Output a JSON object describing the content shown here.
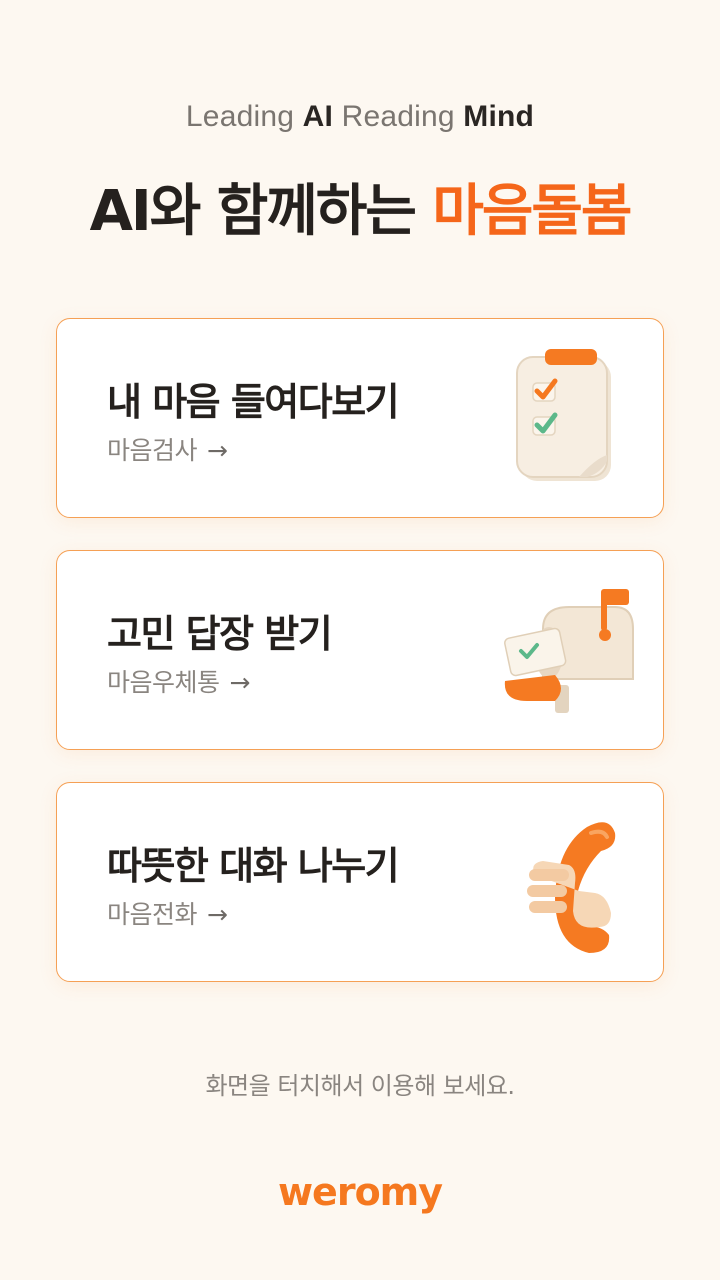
{
  "header": {
    "tagline_parts": [
      "Leading ",
      "AI",
      " Reading ",
      "Mind"
    ],
    "headline_main": "AI와 함께하는 ",
    "headline_accent": "마음돌봄",
    "accent_color": "#f5661a"
  },
  "cards": [
    {
      "title": "내 마음 들여다보기",
      "subtitle": "마음검사",
      "arrow": "→",
      "icon": "checklist-clipboard-icon"
    },
    {
      "title": "고민 답장 받기",
      "subtitle": "마음우체통",
      "arrow": "→",
      "icon": "mailbox-icon"
    },
    {
      "title": "따뜻한 대화 나누기",
      "subtitle": "마음전화",
      "arrow": "→",
      "icon": "phone-handset-icon"
    }
  ],
  "footer": {
    "hint": "화면을 터치해서 이용해 보세요.",
    "logo": "weromy"
  }
}
